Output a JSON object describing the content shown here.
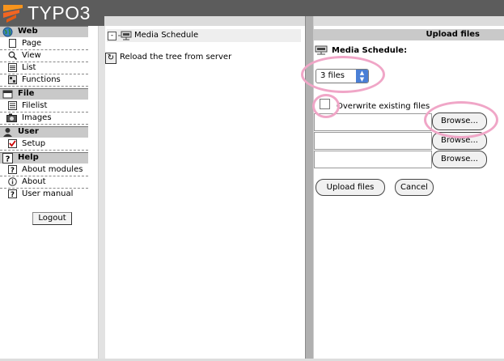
{
  "header": {
    "logo_text": "TYPO3"
  },
  "menu": {
    "groups": [
      {
        "label": "Web",
        "icon": "globe-icon",
        "items": [
          {
            "label": "Page",
            "icon": "page-icon"
          },
          {
            "label": "View",
            "icon": "magnifier-icon"
          },
          {
            "label": "List",
            "icon": "list-icon"
          },
          {
            "label": "Functions",
            "icon": "functions-icon"
          }
        ]
      },
      {
        "label": "File",
        "icon": "file-icon",
        "items": [
          {
            "label": "Filelist",
            "icon": "filelist-icon"
          },
          {
            "label": "Images",
            "icon": "camera-icon"
          }
        ]
      },
      {
        "label": "User",
        "icon": "user-icon",
        "items": [
          {
            "label": "Setup",
            "icon": "checkbox-icon"
          }
        ]
      },
      {
        "label": "Help",
        "icon": "help-icon",
        "items": [
          {
            "label": "About modules",
            "icon": "question-icon"
          },
          {
            "label": "About",
            "icon": "info-icon"
          },
          {
            "label": "User manual",
            "icon": "question-icon"
          }
        ]
      }
    ],
    "logout_label": "Logout"
  },
  "tree": {
    "toggle": "-",
    "root_label": "Media Schedule",
    "reload_label": "Reload the tree from server"
  },
  "upload": {
    "title": "Upload files",
    "page_label": "Media Schedule:",
    "files_select": {
      "value": "3 files"
    },
    "overwrite_label": "Overwrite existing files",
    "overwrite_checked": false,
    "rows": [
      {
        "value": "",
        "browse_label": "Browse..."
      },
      {
        "value": "",
        "browse_label": "Browse..."
      },
      {
        "value": "",
        "browse_label": "Browse..."
      }
    ],
    "upload_label": "Upload files",
    "cancel_label": "Cancel"
  },
  "colors": {
    "header_bg": "#5c5c5c",
    "menu_header_bg": "#c9c9c9",
    "select_arrow": "#4a7fd6",
    "highlight": "#f0a6c7"
  }
}
